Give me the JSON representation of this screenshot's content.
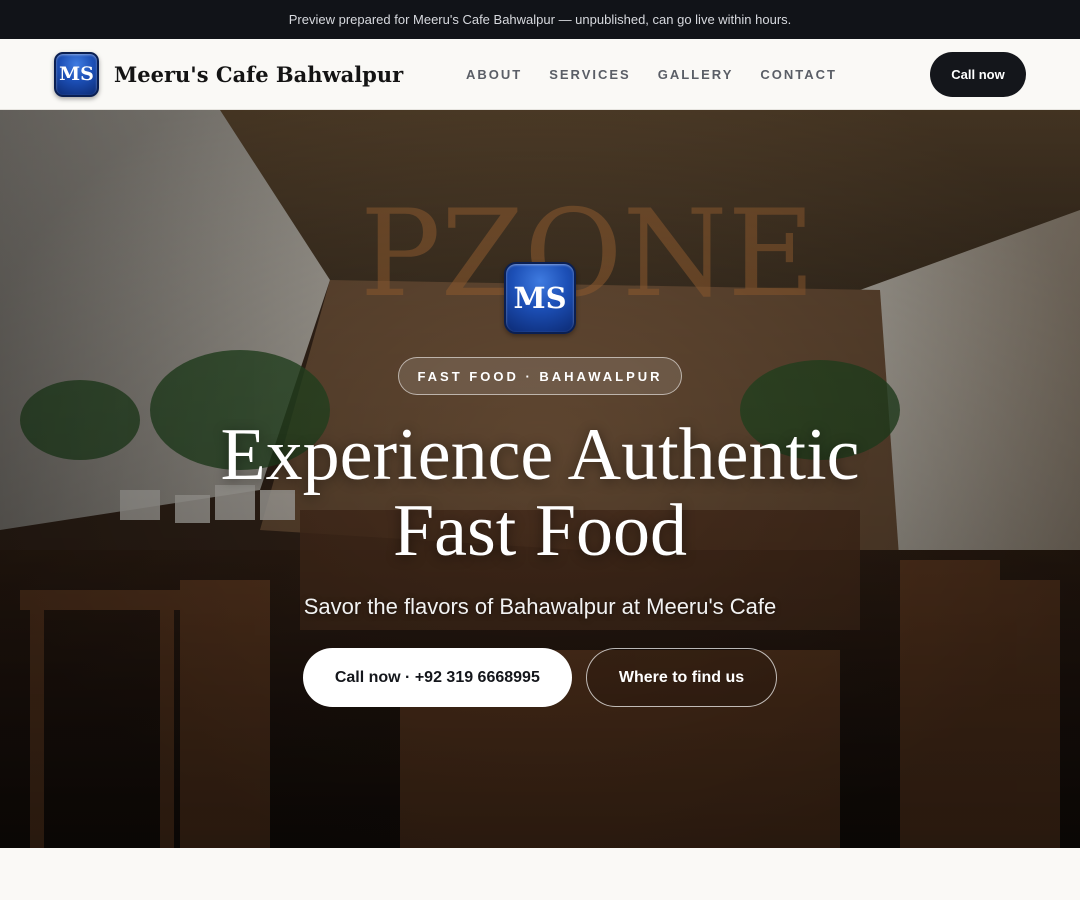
{
  "preview_banner": "Preview prepared for Meeru's Cafe Bahwalpur — unpublished, can go live within hours.",
  "brand": {
    "logo_text": "MS",
    "name": "Meeru's Cafe Bahwalpur"
  },
  "nav": {
    "items": [
      {
        "label": "ABOUT"
      },
      {
        "label": "SERVICES"
      },
      {
        "label": "GALLERY"
      },
      {
        "label": "CONTACT"
      }
    ],
    "cta": "Call now"
  },
  "hero": {
    "logo_text": "MS",
    "tagline": "FAST FOOD · BAHAWALPUR",
    "title": "Experience Authentic Fast Food",
    "subtitle": "Savor the flavors of Bahawalpur at Meeru's Cafe",
    "primary_button": "Call now · +92 319 6668995",
    "secondary_button": "Where to find us",
    "background_sign_text": "PZONE"
  },
  "colors": {
    "dark": "#14161b",
    "page_bg": "#faf9f6",
    "logo_blue": "#1c4fb6"
  }
}
